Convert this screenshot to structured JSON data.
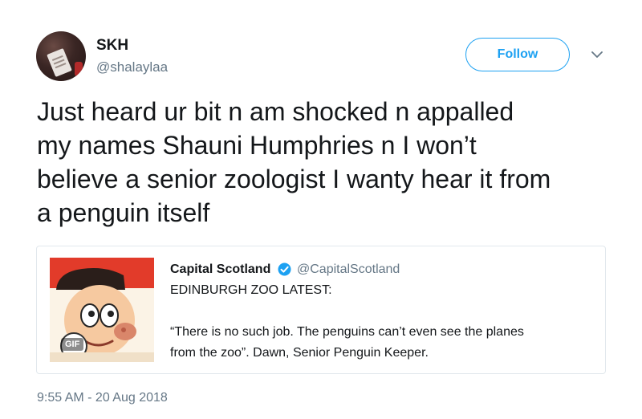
{
  "author": {
    "display_name": "SKH",
    "handle": "@shalaylaa"
  },
  "actions": {
    "follow_label": "Follow",
    "caret_icon": "chevron-down-icon"
  },
  "tweet": {
    "lines": [
      "Just heard ur bit n am shocked n appalled",
      "my names Shauni Humphries n I won’t",
      "believe a senior zoologist I wanty hear it from",
      "a penguin itself"
    ],
    "timestamp": "9:55 AM - 20 Aug 2018"
  },
  "quoted_tweet": {
    "display_name": "Capital Scotland",
    "handle": "@CapitalScotland",
    "verified_icon": "verified-badge-icon",
    "media_badge": "GIF",
    "lines": [
      "EDINBURGH ZOO LATEST:",
      "“There is no such job. The penguins can’t even see the planes",
      "from the zoo”. Dawn, Senior Penguin Keeper."
    ]
  },
  "colors": {
    "accent": "#1da1f2",
    "secondary_text": "#657786",
    "primary_text": "#14171a",
    "border": "#e1e8ed"
  }
}
